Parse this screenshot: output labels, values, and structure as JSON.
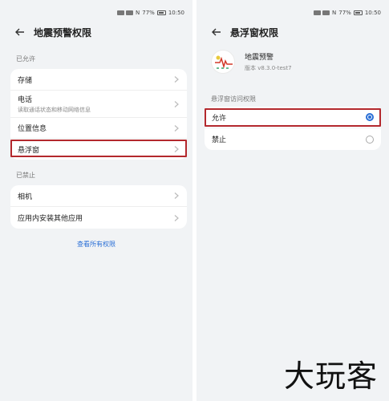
{
  "left": {
    "status": {
      "net": "N",
      "battery": "77%",
      "time": "10:50"
    },
    "title": "地震预警权限",
    "allowed_label": "已允许",
    "allowed_items": [
      {
        "label": "存储",
        "sub": ""
      },
      {
        "label": "电话",
        "sub": "读取通话状态和移动网络信息"
      },
      {
        "label": "位置信息",
        "sub": ""
      },
      {
        "label": "悬浮窗",
        "sub": ""
      }
    ],
    "denied_label": "已禁止",
    "denied_items": [
      {
        "label": "相机"
      },
      {
        "label": "应用内安装其他应用"
      }
    ],
    "view_all": "查看所有权限"
  },
  "right": {
    "status": {
      "net": "N",
      "battery": "77%",
      "time": "10:50"
    },
    "title": "悬浮窗权限",
    "app_name": "地震预警",
    "app_version": "版本 v8.3.0-test7",
    "section_label": "悬浮窗访问权限",
    "options": [
      {
        "label": "允许",
        "selected": true
      },
      {
        "label": "禁止",
        "selected": false
      }
    ]
  },
  "watermark": "大玩客",
  "colors": {
    "accent": "#2a6fd6",
    "highlight": "#b3282d"
  }
}
